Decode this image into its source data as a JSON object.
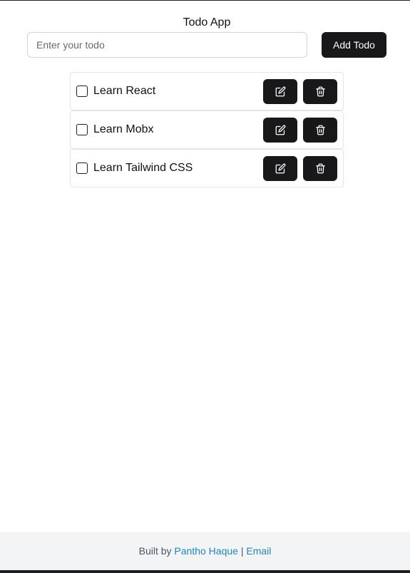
{
  "app": {
    "title": "Todo App"
  },
  "form": {
    "input_placeholder": "Enter your todo",
    "input_value": "",
    "add_button_label": "Add Todo"
  },
  "todos": [
    {
      "label": "Learn React",
      "completed": false,
      "edit_icon": "edit-icon",
      "delete_icon": "trash-icon"
    },
    {
      "label": "Learn Mobx",
      "completed": false,
      "edit_icon": "edit-icon",
      "delete_icon": "trash-icon"
    },
    {
      "label": "Learn Tailwind CSS",
      "completed": false,
      "edit_icon": "edit-icon",
      "delete_icon": "trash-icon"
    }
  ],
  "footer": {
    "prefix": "Built by",
    "author_link": "Pantho Haque",
    "separator": "|",
    "email_link": "Email"
  },
  "colors": {
    "button_bg": "#18181b",
    "button_text": "#ffffff",
    "link": "#1e88b8",
    "footer_bg": "#f3f4f6"
  }
}
